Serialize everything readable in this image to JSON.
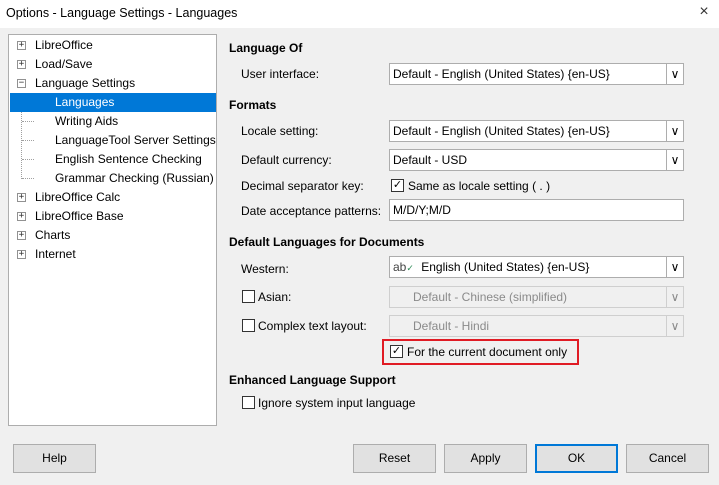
{
  "window": {
    "title": "Options - Language Settings - Languages"
  },
  "tree": {
    "items": [
      {
        "label": "LibreOffice",
        "expander": "+"
      },
      {
        "label": "Load/Save",
        "expander": "+"
      },
      {
        "label": "Language Settings",
        "expander": "−"
      },
      {
        "label": "Languages",
        "selected": true
      },
      {
        "label": "Writing Aids"
      },
      {
        "label": "LanguageTool Server Settings"
      },
      {
        "label": "English Sentence Checking"
      },
      {
        "label": "Grammar Checking (Russian)"
      },
      {
        "label": "LibreOffice Calc",
        "expander": "+"
      },
      {
        "label": "LibreOffice Base",
        "expander": "+"
      },
      {
        "label": "Charts",
        "expander": "+"
      },
      {
        "label": "Internet",
        "expander": "+"
      }
    ]
  },
  "language_of": {
    "heading": "Language Of",
    "user_interface_label": "User interface:",
    "user_interface_value": "Default - English (United States) {en-US}"
  },
  "formats": {
    "heading": "Formats",
    "locale_label": "Locale setting:",
    "locale_value": "Default - English (United States) {en-US}",
    "currency_label": "Default currency:",
    "currency_value": "Default - USD",
    "decimal_label": "Decimal separator key:",
    "decimal_check_label": "Same as locale setting ( . )",
    "decimal_checked": true,
    "date_label": "Date acceptance patterns:",
    "date_value": "M/D/Y;M/D"
  },
  "default_languages": {
    "heading": "Default Languages for Documents",
    "western_label": "Western:",
    "western_value": "English (United States) {en-US}",
    "asian_label": "Asian:",
    "asian_checked": false,
    "asian_value": "Default - Chinese (simplified)",
    "ctl_label": "Complex text layout:",
    "ctl_checked": false,
    "ctl_value": "Default - Hindi",
    "current_doc_label": "For the current document only",
    "current_doc_checked": true
  },
  "enhanced": {
    "heading": "Enhanced Language Support",
    "ignore_label": "Ignore system input language",
    "ignore_checked": false
  },
  "buttons": {
    "help": "Help",
    "reset": "Reset",
    "apply": "Apply",
    "ok": "OK",
    "cancel": "Cancel"
  },
  "icons": {
    "close": "×",
    "check": "✓",
    "dropdown": "∨",
    "spellcheck": "ab"
  },
  "colors": {
    "selection": "#0078d7",
    "highlight_box": "#e01b24",
    "dialog_bg": "#f0f0f0"
  }
}
